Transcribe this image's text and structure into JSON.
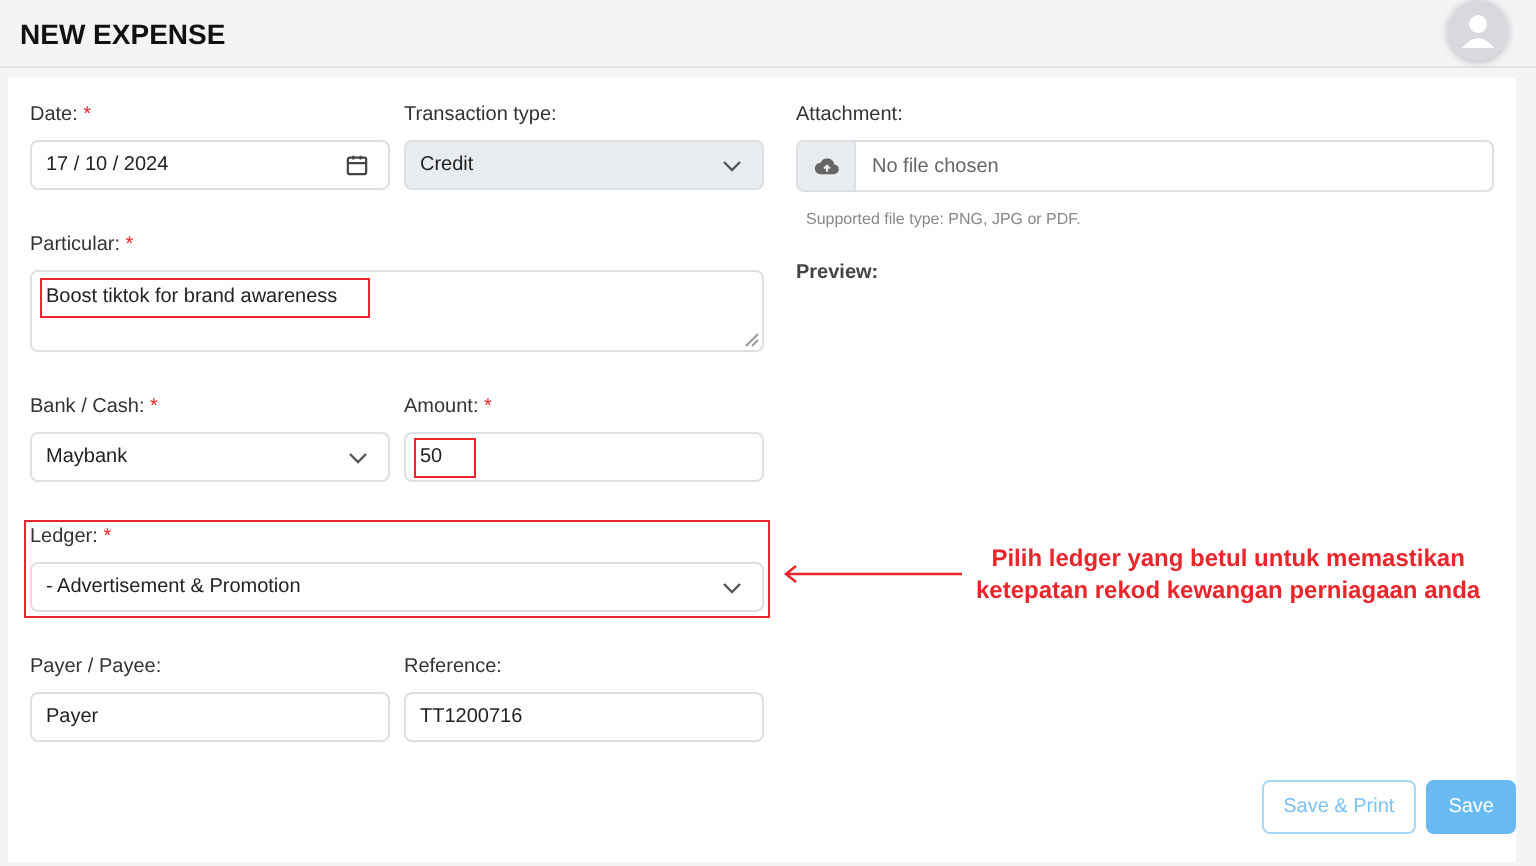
{
  "header": {
    "title": "NEW EXPENSE"
  },
  "form_rows": [
    [
      {
        "label": "Date:",
        "required": true,
        "kind": "date",
        "value": "17 / 10 / 2024",
        "disabled": false,
        "value_highlighted": false,
        "group_highlighted": false
      },
      {
        "label": "Transaction type:",
        "required": false,
        "kind": "select",
        "value": "Credit",
        "disabled": true,
        "value_highlighted": false,
        "group_highlighted": false
      }
    ],
    [
      {
        "label": "Particular:",
        "required": true,
        "kind": "textarea",
        "value": "Boost tiktok for brand awareness",
        "disabled": false,
        "value_highlighted": true,
        "group_highlighted": false
      }
    ],
    [
      {
        "label": "Bank / Cash:",
        "required": true,
        "kind": "select",
        "value": "Maybank",
        "disabled": false,
        "value_highlighted": false,
        "group_highlighted": false
      },
      {
        "label": "Amount:",
        "required": true,
        "kind": "text",
        "value": "50",
        "disabled": false,
        "value_highlighted": true,
        "group_highlighted": false
      }
    ],
    [
      {
        "label": "Ledger:",
        "required": true,
        "kind": "select",
        "value": "- Advertisement & Promotion",
        "disabled": false,
        "value_highlighted": false,
        "group_highlighted": true
      }
    ],
    [
      {
        "label": "Payer / Payee:",
        "required": false,
        "kind": "text",
        "value": "Payer",
        "disabled": false,
        "value_highlighted": false,
        "group_highlighted": false
      },
      {
        "label": "Reference:",
        "required": false,
        "kind": "text",
        "value": "TT1200716",
        "disabled": false,
        "value_highlighted": false,
        "group_highlighted": false
      }
    ]
  ],
  "required_mark": "*",
  "attachment": {
    "label": "Attachment:",
    "file_text": "No file chosen",
    "help": "Supported file type: PNG, JPG or PDF."
  },
  "preview": {
    "label": "Preview:"
  },
  "annotation": {
    "lines": [
      "Pilih ledger yang betul untuk memastikan",
      "ketepatan rekod kewangan perniagaan anda"
    ]
  },
  "buttons": [
    {
      "label": "Save & Print",
      "kind": "outline"
    },
    {
      "label": "Save",
      "kind": "primary"
    }
  ]
}
